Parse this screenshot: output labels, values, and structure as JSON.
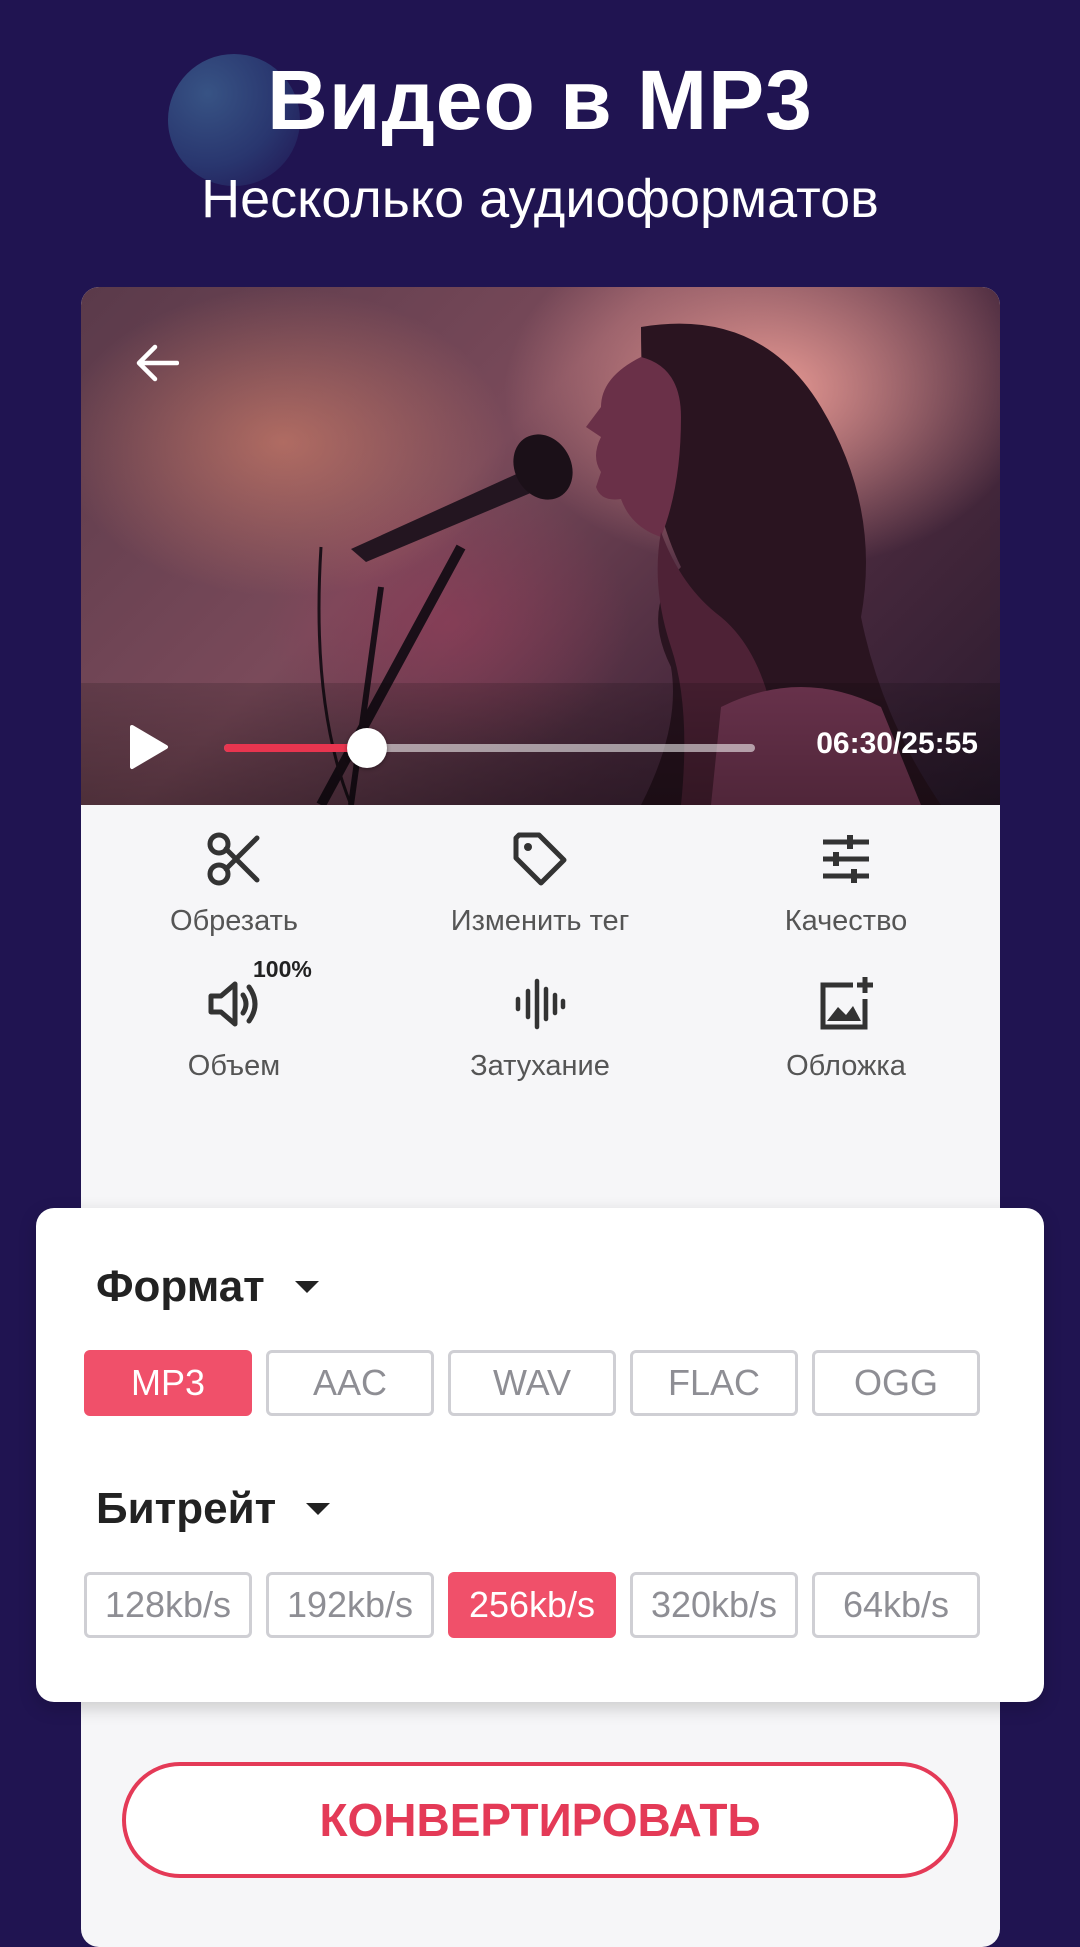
{
  "hero": {
    "title": "Видео в MP3",
    "subtitle": "Несколько аудиоформатов"
  },
  "player": {
    "time": "06:30/25:55",
    "progress": 0.27,
    "back_icon": "arrow-left-icon",
    "play_icon": "play-icon"
  },
  "tools": [
    {
      "label": "Обрезать",
      "icon": "scissors-icon"
    },
    {
      "label": "Изменить тег",
      "icon": "tag-icon"
    },
    {
      "label": "Качество",
      "icon": "sliders-icon"
    },
    {
      "label": "Объем",
      "icon": "volume-icon",
      "badge": "100%"
    },
    {
      "label": "Затухание",
      "icon": "waveform-icon"
    },
    {
      "label": "Обложка",
      "icon": "image-add-icon"
    }
  ],
  "format": {
    "title": "Формат",
    "options": [
      "MP3",
      "AAC",
      "WAV",
      "FLAC",
      "OGG"
    ],
    "selected": "MP3"
  },
  "bitrate": {
    "title": "Битрейт",
    "options": [
      "128kb/s",
      "192kb/s",
      "256kb/s",
      "320kb/s",
      "64kb/s"
    ],
    "selected": "256kb/s"
  },
  "convert_label": "КОНВЕРТИРОВАТЬ",
  "colors": {
    "background": "#201451",
    "accent": "#f0506a",
    "convert": "#e43a57"
  }
}
